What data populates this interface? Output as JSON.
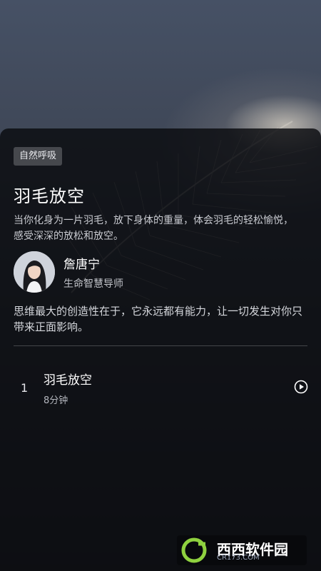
{
  "category_tag": "自然呼吸",
  "course": {
    "title": "羽毛放空",
    "description": "当你化身为一片羽毛，放下身体的重量，体会羽毛的轻松愉悦，感受深深的放松和放空。"
  },
  "author": {
    "name": "詹唐宁",
    "title": "生命智慧导师"
  },
  "quote": "思维最大的创造性在于，它永远都有能力，让一切发生对你只带来正面影响。",
  "tracks": [
    {
      "number": "1",
      "title": "羽毛放空",
      "duration": "8分钟",
      "icon": "play-circle-icon"
    }
  ],
  "watermark": {
    "name": "西西软件园",
    "domain": "CR173.COM"
  }
}
